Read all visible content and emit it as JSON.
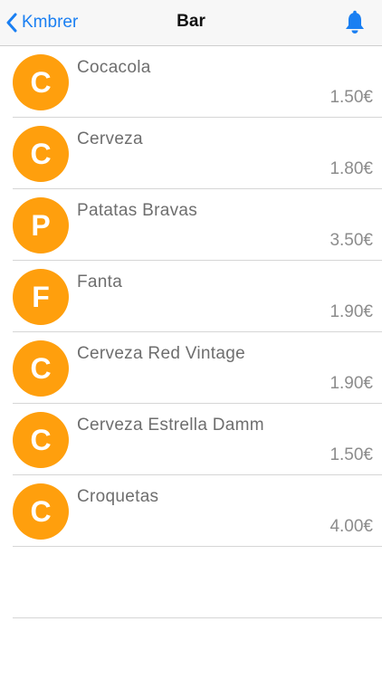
{
  "nav": {
    "back_label": "Kmbrer",
    "title": "Bar",
    "bell_icon": "bell-icon",
    "accent_color": "#1a7ff2"
  },
  "avatar_color": "#ff9f0d",
  "items": [
    {
      "initial": "C",
      "name": "Cocacola",
      "price": "1.50€"
    },
    {
      "initial": "C",
      "name": "Cerveza",
      "price": "1.80€"
    },
    {
      "initial": "P",
      "name": "Patatas Bravas",
      "price": "3.50€"
    },
    {
      "initial": "F",
      "name": "Fanta",
      "price": "1.90€"
    },
    {
      "initial": "C",
      "name": "Cerveza Red Vintage",
      "price": "1.90€"
    },
    {
      "initial": "C",
      "name": "Cerveza Estrella Damm",
      "price": "1.50€"
    },
    {
      "initial": "C",
      "name": "Croquetas",
      "price": "4.00€"
    }
  ]
}
